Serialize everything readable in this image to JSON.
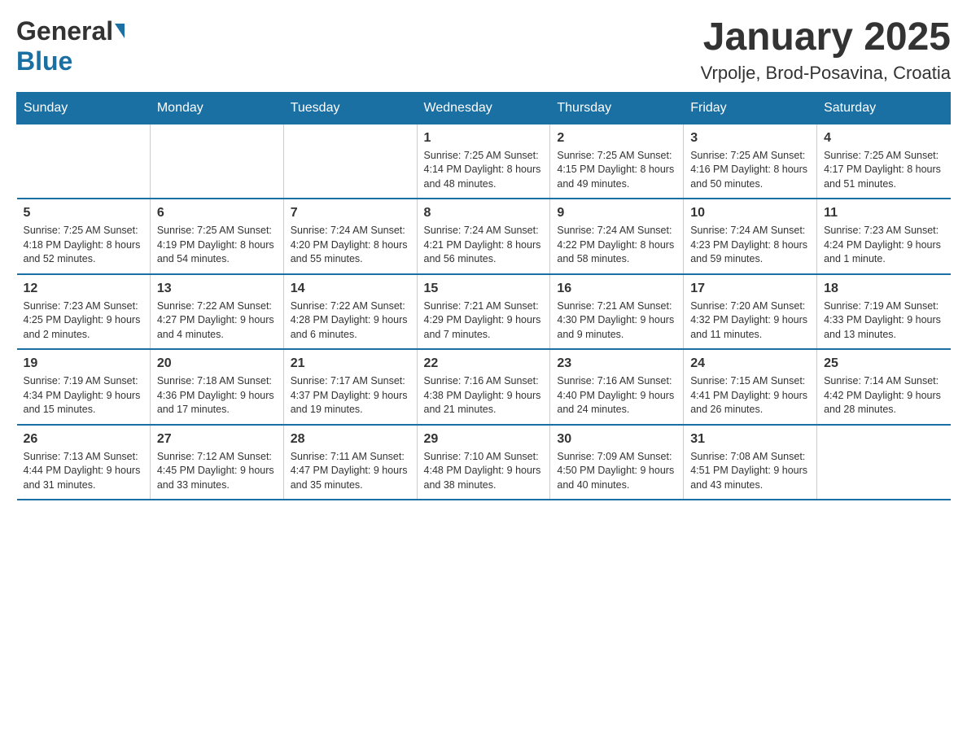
{
  "logo": {
    "general": "General",
    "blue": "Blue",
    "arrow": "▶"
  },
  "title": "January 2025",
  "subtitle": "Vrpolje, Brod-Posavina, Croatia",
  "days_of_week": [
    "Sunday",
    "Monday",
    "Tuesday",
    "Wednesday",
    "Thursday",
    "Friday",
    "Saturday"
  ],
  "weeks": [
    [
      {
        "day": "",
        "info": ""
      },
      {
        "day": "",
        "info": ""
      },
      {
        "day": "",
        "info": ""
      },
      {
        "day": "1",
        "info": "Sunrise: 7:25 AM\nSunset: 4:14 PM\nDaylight: 8 hours\nand 48 minutes."
      },
      {
        "day": "2",
        "info": "Sunrise: 7:25 AM\nSunset: 4:15 PM\nDaylight: 8 hours\nand 49 minutes."
      },
      {
        "day": "3",
        "info": "Sunrise: 7:25 AM\nSunset: 4:16 PM\nDaylight: 8 hours\nand 50 minutes."
      },
      {
        "day": "4",
        "info": "Sunrise: 7:25 AM\nSunset: 4:17 PM\nDaylight: 8 hours\nand 51 minutes."
      }
    ],
    [
      {
        "day": "5",
        "info": "Sunrise: 7:25 AM\nSunset: 4:18 PM\nDaylight: 8 hours\nand 52 minutes."
      },
      {
        "day": "6",
        "info": "Sunrise: 7:25 AM\nSunset: 4:19 PM\nDaylight: 8 hours\nand 54 minutes."
      },
      {
        "day": "7",
        "info": "Sunrise: 7:24 AM\nSunset: 4:20 PM\nDaylight: 8 hours\nand 55 minutes."
      },
      {
        "day": "8",
        "info": "Sunrise: 7:24 AM\nSunset: 4:21 PM\nDaylight: 8 hours\nand 56 minutes."
      },
      {
        "day": "9",
        "info": "Sunrise: 7:24 AM\nSunset: 4:22 PM\nDaylight: 8 hours\nand 58 minutes."
      },
      {
        "day": "10",
        "info": "Sunrise: 7:24 AM\nSunset: 4:23 PM\nDaylight: 8 hours\nand 59 minutes."
      },
      {
        "day": "11",
        "info": "Sunrise: 7:23 AM\nSunset: 4:24 PM\nDaylight: 9 hours\nand 1 minute."
      }
    ],
    [
      {
        "day": "12",
        "info": "Sunrise: 7:23 AM\nSunset: 4:25 PM\nDaylight: 9 hours\nand 2 minutes."
      },
      {
        "day": "13",
        "info": "Sunrise: 7:22 AM\nSunset: 4:27 PM\nDaylight: 9 hours\nand 4 minutes."
      },
      {
        "day": "14",
        "info": "Sunrise: 7:22 AM\nSunset: 4:28 PM\nDaylight: 9 hours\nand 6 minutes."
      },
      {
        "day": "15",
        "info": "Sunrise: 7:21 AM\nSunset: 4:29 PM\nDaylight: 9 hours\nand 7 minutes."
      },
      {
        "day": "16",
        "info": "Sunrise: 7:21 AM\nSunset: 4:30 PM\nDaylight: 9 hours\nand 9 minutes."
      },
      {
        "day": "17",
        "info": "Sunrise: 7:20 AM\nSunset: 4:32 PM\nDaylight: 9 hours\nand 11 minutes."
      },
      {
        "day": "18",
        "info": "Sunrise: 7:19 AM\nSunset: 4:33 PM\nDaylight: 9 hours\nand 13 minutes."
      }
    ],
    [
      {
        "day": "19",
        "info": "Sunrise: 7:19 AM\nSunset: 4:34 PM\nDaylight: 9 hours\nand 15 minutes."
      },
      {
        "day": "20",
        "info": "Sunrise: 7:18 AM\nSunset: 4:36 PM\nDaylight: 9 hours\nand 17 minutes."
      },
      {
        "day": "21",
        "info": "Sunrise: 7:17 AM\nSunset: 4:37 PM\nDaylight: 9 hours\nand 19 minutes."
      },
      {
        "day": "22",
        "info": "Sunrise: 7:16 AM\nSunset: 4:38 PM\nDaylight: 9 hours\nand 21 minutes."
      },
      {
        "day": "23",
        "info": "Sunrise: 7:16 AM\nSunset: 4:40 PM\nDaylight: 9 hours\nand 24 minutes."
      },
      {
        "day": "24",
        "info": "Sunrise: 7:15 AM\nSunset: 4:41 PM\nDaylight: 9 hours\nand 26 minutes."
      },
      {
        "day": "25",
        "info": "Sunrise: 7:14 AM\nSunset: 4:42 PM\nDaylight: 9 hours\nand 28 minutes."
      }
    ],
    [
      {
        "day": "26",
        "info": "Sunrise: 7:13 AM\nSunset: 4:44 PM\nDaylight: 9 hours\nand 31 minutes."
      },
      {
        "day": "27",
        "info": "Sunrise: 7:12 AM\nSunset: 4:45 PM\nDaylight: 9 hours\nand 33 minutes."
      },
      {
        "day": "28",
        "info": "Sunrise: 7:11 AM\nSunset: 4:47 PM\nDaylight: 9 hours\nand 35 minutes."
      },
      {
        "day": "29",
        "info": "Sunrise: 7:10 AM\nSunset: 4:48 PM\nDaylight: 9 hours\nand 38 minutes."
      },
      {
        "day": "30",
        "info": "Sunrise: 7:09 AM\nSunset: 4:50 PM\nDaylight: 9 hours\nand 40 minutes."
      },
      {
        "day": "31",
        "info": "Sunrise: 7:08 AM\nSunset: 4:51 PM\nDaylight: 9 hours\nand 43 minutes."
      },
      {
        "day": "",
        "info": ""
      }
    ]
  ]
}
